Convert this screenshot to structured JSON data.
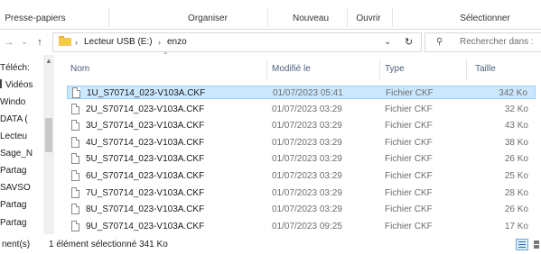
{
  "ribbon": {
    "groups": [
      "Presse-papiers",
      "Organiser",
      "Nouveau",
      "Ouvrir",
      "Sélectionner"
    ]
  },
  "address": {
    "path": [
      "Lecteur USB (E:)",
      "enzo"
    ],
    "search_placeholder": "Rechercher dans :"
  },
  "nav_pane": {
    "items": [
      "Téléch:",
      "Vidéos",
      "Windo",
      "DATA (",
      "Lecteu",
      "Sage_N",
      "Partag",
      "SAVSO",
      "Partag",
      "Partag"
    ]
  },
  "columns": {
    "name": "Nom",
    "modified": "Modifié le",
    "type": "Type",
    "size": "Taille"
  },
  "files": [
    {
      "name": "1U_S70714_023-V103A.CKF",
      "modified": "01/07/2023 05:41",
      "type": "Fichier CKF",
      "size": "342 Ko",
      "selected": true
    },
    {
      "name": "2U_S70714_023-V103A.CKF",
      "modified": "01/07/2023 03:29",
      "type": "Fichier CKF",
      "size": "32 Ko",
      "selected": false
    },
    {
      "name": "3U_S70714_023-V103A.CKF",
      "modified": "01/07/2023 03:29",
      "type": "Fichier CKF",
      "size": "43 Ko",
      "selected": false
    },
    {
      "name": "4U_S70714_023-V103A.CKF",
      "modified": "01/07/2023 03:29",
      "type": "Fichier CKF",
      "size": "38 Ko",
      "selected": false
    },
    {
      "name": "5U_S70714_023-V103A.CKF",
      "modified": "01/07/2023 03:29",
      "type": "Fichier CKF",
      "size": "26 Ko",
      "selected": false
    },
    {
      "name": "6U_S70714_023-V103A.CKF",
      "modified": "01/07/2023 03:29",
      "type": "Fichier CKF",
      "size": "25 Ko",
      "selected": false
    },
    {
      "name": "7U_S70714_023-V103A.CKF",
      "modified": "01/07/2023 03:29",
      "type": "Fichier CKF",
      "size": "28 Ko",
      "selected": false
    },
    {
      "name": "8U_S70714_023-V103A.CKF",
      "modified": "01/07/2023 03:29",
      "type": "Fichier CKF",
      "size": "26 Ko",
      "selected": false
    },
    {
      "name": "9U_S70714_023-V103A.CKF",
      "modified": "01/07/2023 09:25",
      "type": "Fichier CKF",
      "size": "17 Ko",
      "selected": false
    }
  ],
  "status": {
    "count": "nent(s)",
    "selection": "1 élément sélectionné  341 Ko"
  },
  "icons": {
    "back": "back-arrow-icon",
    "forward": "forward-arrow-icon",
    "recent": "chevron-down-icon",
    "up": "up-arrow-icon",
    "refresh": "refresh-icon",
    "search": "search-icon",
    "file": "file-icon",
    "folder": "folder-icon"
  },
  "colors": {
    "selection_bg": "#cce8ff",
    "selection_border": "#99d1ff",
    "header_text": "#4c607a"
  }
}
